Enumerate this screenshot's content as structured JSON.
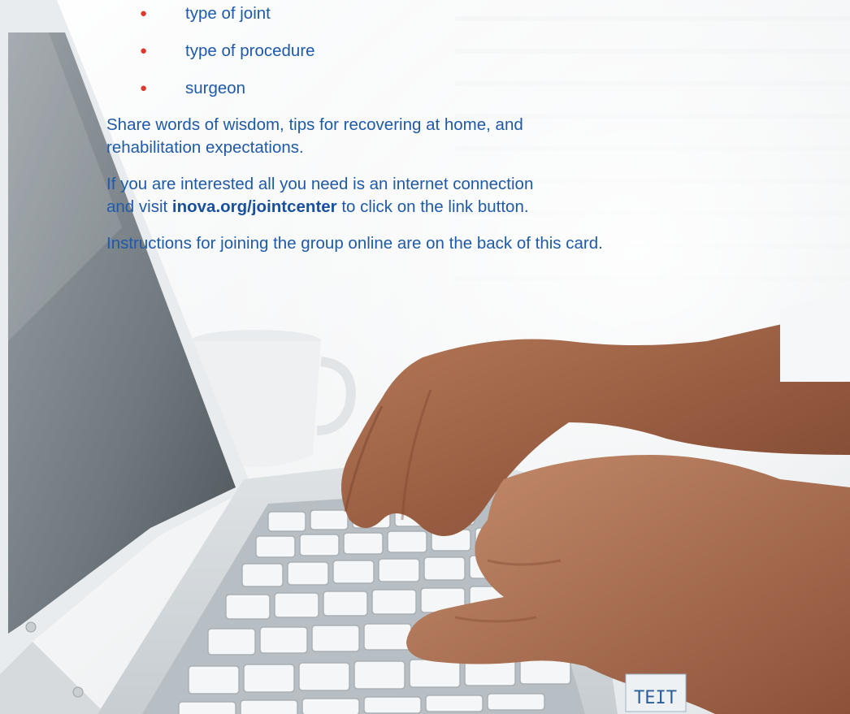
{
  "bullets": [
    {
      "text": "type of joint"
    },
    {
      "text": "type of procedure"
    },
    {
      "text": "surgeon"
    }
  ],
  "paragraphs": {
    "share_line1": "Share words of wisdom, tips for recovering at home, and",
    "share_line2": "rehabilitation expectations.",
    "interest_line1": "If you are interested all you need is an internet connection",
    "interest_line2_prefix": "and visit ",
    "interest_link": "inova.org/jointcenter",
    "interest_line2_suffix": " to click on the link button.",
    "instructions": "Instructions for joining the group online are on the back of this card."
  },
  "photo": {
    "keyboard_label": "TEIT",
    "colors": {
      "text": "#1f5aa8",
      "bullet": "#e2372b"
    }
  }
}
